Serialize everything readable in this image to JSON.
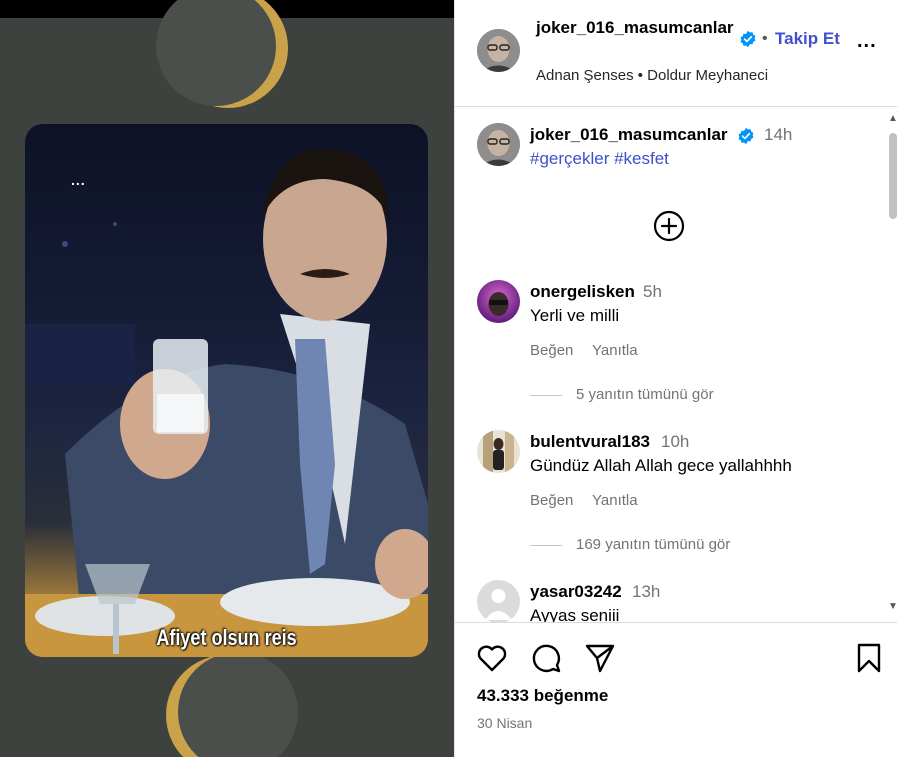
{
  "post": {
    "caption_overlay": "Afiyet olsun reis",
    "overlay_dots": "..."
  },
  "header": {
    "username": "joker_016_masumcanlar",
    "separator": "•",
    "follow_label": "Takip Et",
    "more": "...",
    "subtitle": "Adnan Şenses • Doldur Meyhaneci"
  },
  "caption": {
    "username": "joker_016_masumcanlar",
    "time": "14h",
    "hashtags": "#gerçekler #kesfet"
  },
  "comments": [
    {
      "username": "onergelisken",
      "time": "5h",
      "text": "Yerli ve milli",
      "like_label": "Beğen",
      "reply_label": "Yanıtla",
      "view_replies": "5 yanıtın tümünü gör"
    },
    {
      "username": "bulentvural183",
      "time": "10h",
      "text": "Gündüz Allah Allah gece yallahhhh",
      "like_label": "Beğen",
      "reply_label": "Yanıtla",
      "view_replies": "169 yanıtın tümünü gör"
    },
    {
      "username": "yasar03242",
      "time": "13h",
      "text": "Ayyas seniii"
    }
  ],
  "footer": {
    "likes": "43.333 beğenme",
    "date": "30 Nisan"
  },
  "colors": {
    "accent": "#4150d0",
    "verified": "#0095f6",
    "muted": "#737373"
  }
}
